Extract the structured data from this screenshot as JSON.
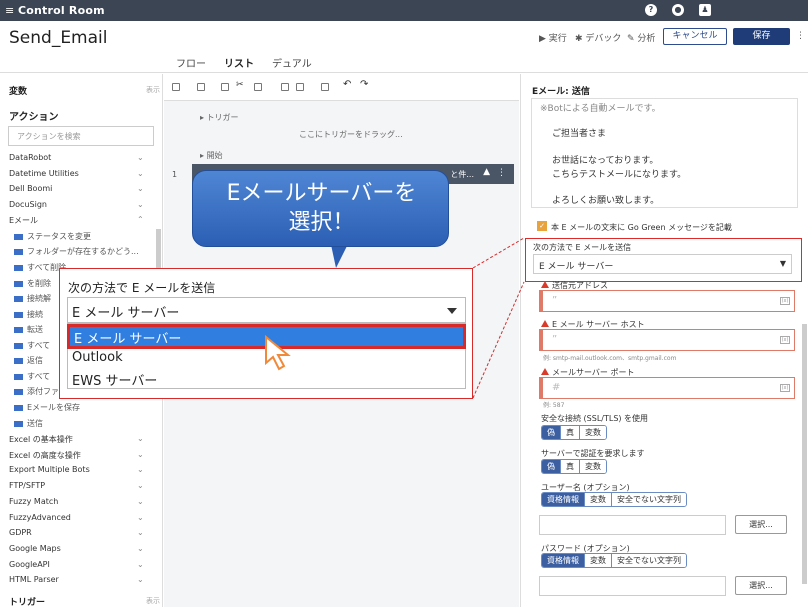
{
  "topbar": {
    "title": "Control Room"
  },
  "header": {
    "bot_name": "Send_Email",
    "tabs": [
      "フロー",
      "リスト",
      "デュアル"
    ],
    "actions": {
      "run": "実行",
      "debug": "デバック",
      "analyze": "分析",
      "cancel": "キャンセル",
      "save": "保存"
    }
  },
  "left": {
    "variables": "変数",
    "variables_aux": "表示",
    "actions": "アクション",
    "search_placeholder": "アクションを検索",
    "groups_top": [
      "DataRobot",
      "Datetime Utilities",
      "Dell Boomi",
      "DocuSign",
      "Eメール"
    ],
    "email_actions": [
      "ステータスを変更",
      "フォルダーが存在するかどう...",
      "すべて削除",
      "を削除",
      "接続解",
      "接続",
      "転送",
      "すべて",
      "返信",
      "すべて",
      "添付ファ",
      "Eメールを保存",
      "送信"
    ],
    "groups_bottom": [
      "Excel の基本操作",
      "Excel の高度な操作",
      "Export Multiple Bots",
      "FTP/SFTP",
      "Fuzzy Match",
      "FuzzyAdvanced",
      "GDPR",
      "Google Maps",
      "GoogleAPI",
      "HTML Parser"
    ],
    "triggers": "トリガー",
    "triggers_aux": "表示"
  },
  "center": {
    "trigger": "トリガー",
    "trigger_drop": "ここにトリガーをドラッグ...",
    "start": "開始",
    "line_number": "1",
    "action_text": "と件..."
  },
  "right": {
    "title": "Eメール: 送信",
    "message_lines": [
      "※Botによる自動メールです。",
      "ご担当者さま",
      "お世話になっております。",
      "こちらテストメールになります。",
      "よろしくお願い致します。"
    ],
    "green_label": "本 E メールの文末に Go Green メッセージを記載",
    "send_method_label": "次の方法で E メールを送信",
    "send_method_value": "E メール サーバー",
    "from_label": "送信元アドレス",
    "host_label": "E メール サーバー ホスト",
    "host_hint": "例: smtp-mail.outlook.com、smtp.gmail.com",
    "port_label": "メールサーバー ポート",
    "port_hint": "例: 587",
    "ssl_label": "安全な接続 (SSL/TLS) を使用",
    "auth_label": "サーバーで認証を要求します",
    "bool_opts": [
      "偽",
      "真",
      "変数"
    ],
    "user_label": "ユーザー名 (オプション)",
    "pass_label": "パスワード (オプション)",
    "cred_opts": [
      "資格情報",
      "変数",
      "安全でない文字列"
    ],
    "select_btn": "選択..."
  },
  "callout": {
    "line1": "Eメールサーバーを",
    "line2": "選択！"
  },
  "zoom": {
    "label": "次の方法で E メールを送信",
    "value": "E メール サーバー",
    "options": [
      "E メール サーバー",
      "Outlook",
      "EWS サーバー"
    ]
  }
}
